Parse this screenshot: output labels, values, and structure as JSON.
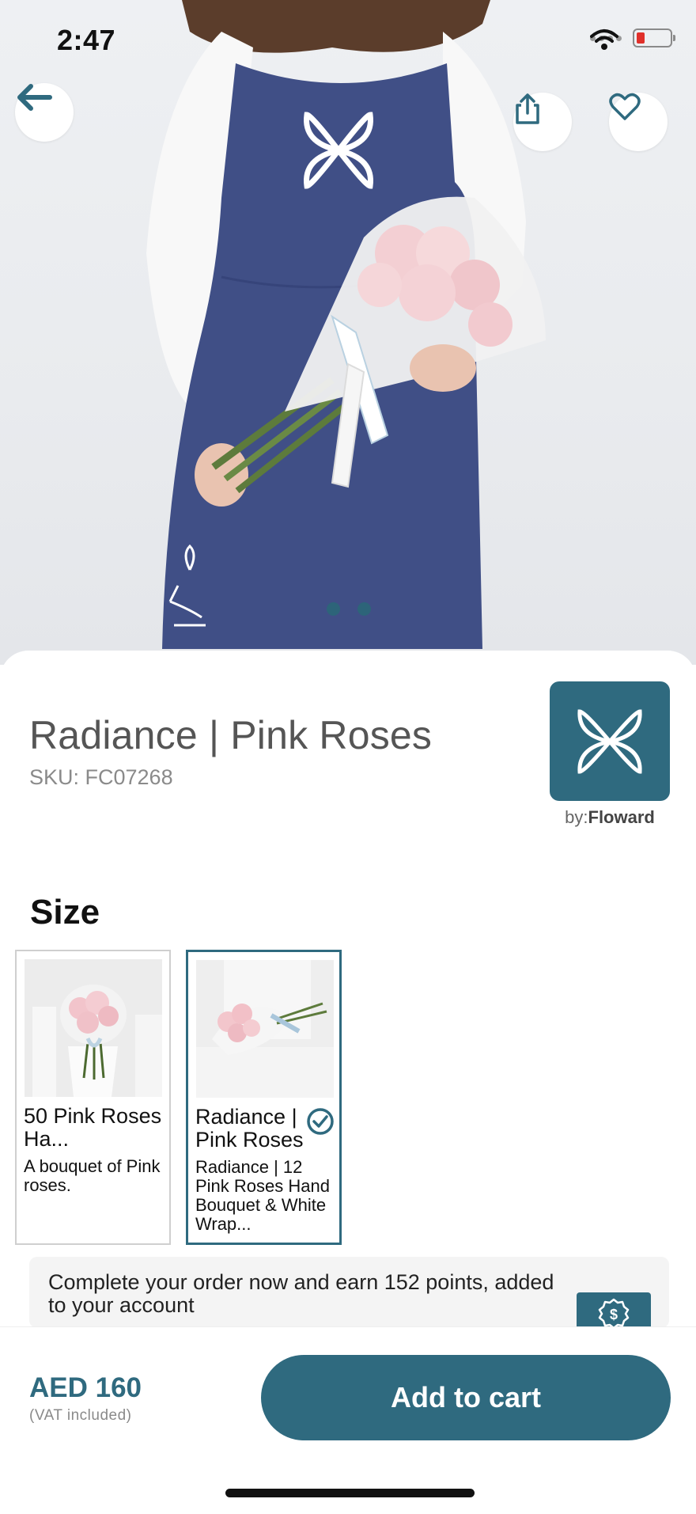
{
  "status_bar": {
    "time": "2:47"
  },
  "product": {
    "title": "Radiance | Pink Roses",
    "sku": "SKU: FC07268"
  },
  "brand": {
    "by_prefix": "by:",
    "name": "Floward"
  },
  "size_section": {
    "label": "Size",
    "options": [
      {
        "title": "50 Pink Roses Ha...",
        "description": "A bouquet of Pink roses.",
        "selected": false
      },
      {
        "title": "Radiance | Pink Roses",
        "description": "Radiance | 12 Pink Roses Hand Bouquet & White Wrap...",
        "selected": true
      }
    ]
  },
  "points_banner": {
    "text": "Complete your order now and earn 152 points, added to your account"
  },
  "purchase": {
    "price": "AED 160",
    "vat_note": "(VAT included)",
    "add_to_cart_label": "Add to cart"
  },
  "gallery": {
    "page_count": 2,
    "current_page": 1
  },
  "icons": {
    "back": "arrow-left-icon",
    "share": "share-icon",
    "favorite": "heart-icon",
    "selected": "check-circle-icon",
    "points": "coin-badge-icon"
  },
  "colors": {
    "accent": "#2f6a7f",
    "apron": "#404f86",
    "battery_low": "#e0302a"
  }
}
